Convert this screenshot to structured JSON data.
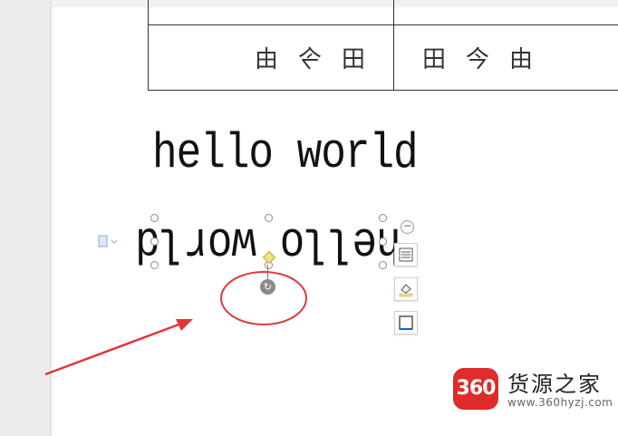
{
  "table": {
    "left_cell": [
      "由",
      "今",
      "田"
    ],
    "right_cell": [
      "田",
      "今",
      "由"
    ]
  },
  "text": {
    "normal": "hello world",
    "flipped": "hello world"
  },
  "toolbar": {
    "collapse_label": "−",
    "icons": [
      "layout-options-icon",
      "fill-color-icon",
      "border-icon"
    ]
  },
  "rotate_glyph": "↻",
  "watermark": {
    "badge": "360",
    "name": "货源之家",
    "url": "www.360hyzj.com"
  },
  "colors": {
    "annotation_red": "#e0363a",
    "badge_red": "#e02b2b",
    "diamond_yellow": "#f2e37a"
  }
}
